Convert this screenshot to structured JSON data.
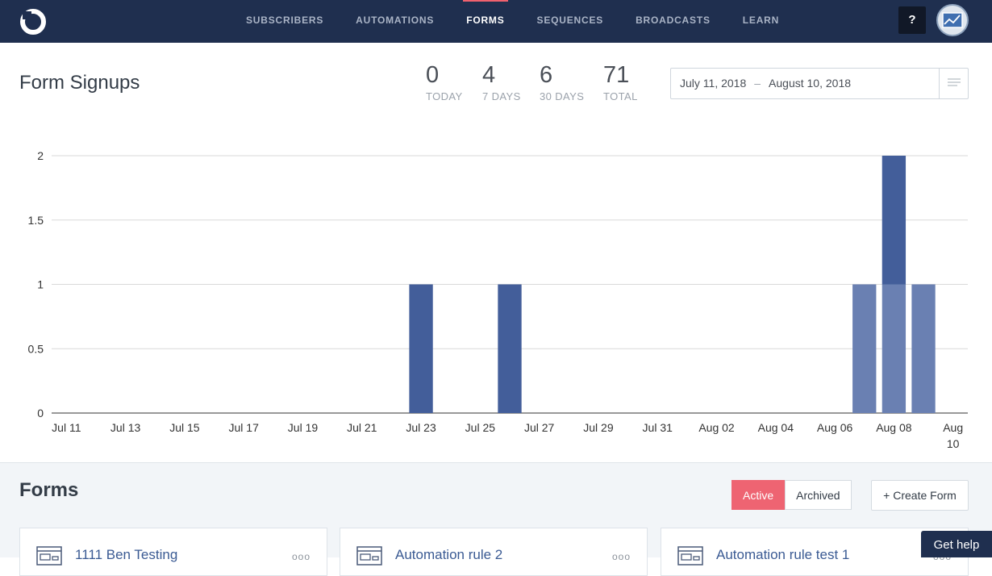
{
  "nav": {
    "items": [
      {
        "label": "SUBSCRIBERS",
        "active": false
      },
      {
        "label": "AUTOMATIONS",
        "active": false
      },
      {
        "label": "FORMS",
        "active": true
      },
      {
        "label": "SEQUENCES",
        "active": false
      },
      {
        "label": "BROADCASTS",
        "active": false
      },
      {
        "label": "LEARN",
        "active": false
      }
    ],
    "help_label": "?",
    "logo_icon": "convertkit-logo-icon",
    "avatar_icon": "user-avatar-icon"
  },
  "header": {
    "title": "Form Signups",
    "stats": [
      {
        "value": "0",
        "label": "TODAY"
      },
      {
        "value": "4",
        "label": "7 DAYS"
      },
      {
        "value": "6",
        "label": "30 DAYS"
      },
      {
        "value": "71",
        "label": "TOTAL"
      }
    ],
    "date_range": {
      "start": "July 11, 2018",
      "separator": "–",
      "end": "August 10, 2018",
      "menu_icon": "filter-lines-icon"
    }
  },
  "chart_data": {
    "type": "bar",
    "stacked": true,
    "x_tick_labels": [
      "Jul 11",
      "Jul 13",
      "Jul 15",
      "Jul 17",
      "Jul 19",
      "Jul 21",
      "Jul 23",
      "Jul 25",
      "Jul 27",
      "Jul 29",
      "Jul 31",
      "Aug 02",
      "Aug 04",
      "Aug 06",
      "Aug 08",
      "Aug 10"
    ],
    "x_days_range": [
      11,
      41
    ],
    "y_ticks": [
      "0",
      "0.5",
      "1",
      "1.5",
      "2"
    ],
    "ylim": [
      0,
      2
    ],
    "grid": true,
    "bars": [
      {
        "date": "Jul 23",
        "day": 23,
        "segments": [
          {
            "value": 1,
            "color": "#435e9a"
          }
        ]
      },
      {
        "date": "Jul 26",
        "day": 26,
        "segments": [
          {
            "value": 1,
            "color": "#435e9a"
          }
        ]
      },
      {
        "date": "Aug 07",
        "day": 38,
        "segments": [
          {
            "value": 1,
            "color": "#6a80b2"
          }
        ]
      },
      {
        "date": "Aug 08",
        "day": 39,
        "segments": [
          {
            "value": 1,
            "color": "#6a80b2"
          },
          {
            "value": 1,
            "color": "#435e9a"
          }
        ]
      },
      {
        "date": "Aug 09",
        "day": 40,
        "segments": [
          {
            "value": 1,
            "color": "#6a80b2"
          }
        ]
      }
    ]
  },
  "forms": {
    "title": "Forms",
    "filter": {
      "active_label": "Active",
      "archived_label": "Archived"
    },
    "create_label": "+ Create Form",
    "cards": [
      {
        "name": "1111 Ben Testing",
        "icon": "form-window-icon",
        "more": "ooo"
      },
      {
        "name": "Automation rule 2",
        "icon": "form-window-icon",
        "more": "ooo"
      },
      {
        "name": "Automation rule test 1",
        "icon": "form-window-icon",
        "more": "ooo"
      }
    ]
  },
  "help_widget": {
    "label": "Get help"
  }
}
